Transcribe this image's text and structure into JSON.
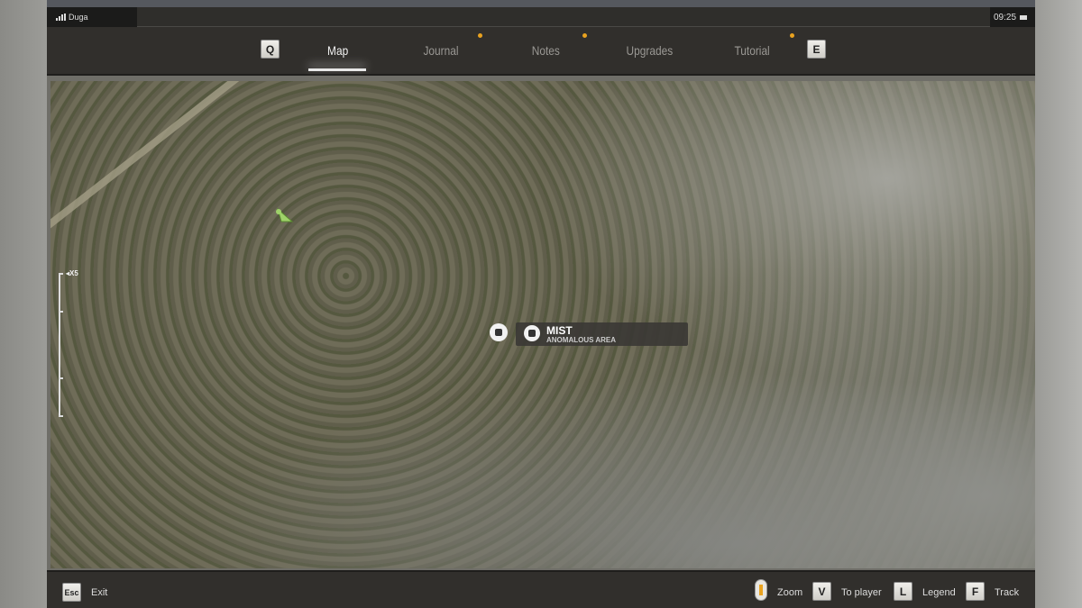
{
  "status": {
    "carrier": "Duga",
    "time": "09:25"
  },
  "nav": {
    "prev_key": "Q",
    "next_key": "E",
    "tabs": [
      {
        "label": "Map",
        "active": true,
        "notification": false
      },
      {
        "label": "Journal",
        "notification": true
      },
      {
        "label": "Notes",
        "notification": true
      },
      {
        "label": "Upgrades",
        "notification": true
      },
      {
        "label": "Tutorial",
        "notification": false
      }
    ]
  },
  "map": {
    "zoom_label": "X5",
    "marker": {
      "title": "MIST",
      "subtitle": "ANOMALOUS AREA"
    }
  },
  "footer": {
    "exit_key": "Esc",
    "exit_label": "Exit",
    "zoom_label": "Zoom",
    "to_player_key": "V",
    "to_player_label": "To player",
    "legend_key": "L",
    "legend_label": "Legend",
    "track_key": "F",
    "track_label": "Track"
  },
  "colors": {
    "notification": "#e9a21f",
    "panel": "#312f2c"
  }
}
